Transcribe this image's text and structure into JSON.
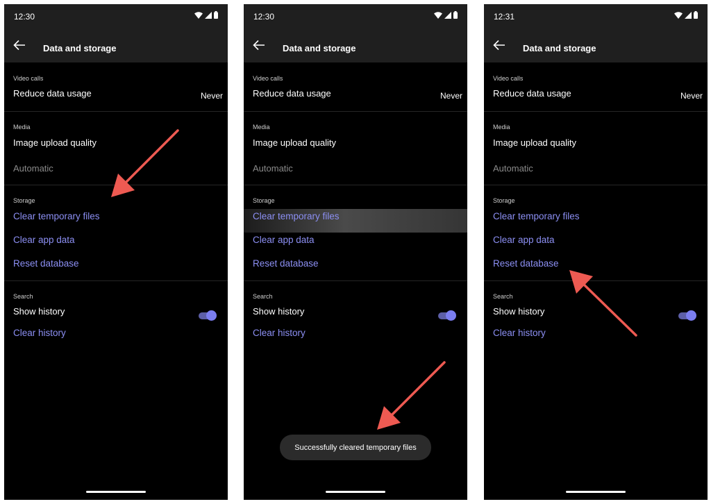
{
  "colors": {
    "background": "#000000",
    "app_bar": "#1f1f1f",
    "link": "#8c8ff3",
    "toggle_on": "#7b7ef0",
    "annotation_arrow": "#ee5a52"
  },
  "screens": [
    {
      "status": {
        "time": "12:30",
        "icons": [
          "wifi-icon",
          "signal-icon",
          "battery-icon"
        ]
      },
      "header": {
        "title": "Data and storage",
        "back_icon": "arrow-left-icon"
      },
      "video_calls": {
        "label": "Video calls",
        "reduce_data": "Reduce data usage",
        "reduce_data_value": "Never"
      },
      "media": {
        "label": "Media",
        "image_quality": "Image upload quality",
        "image_quality_value": "Automatic"
      },
      "storage": {
        "label": "Storage",
        "clear_temp": "Clear temporary files",
        "clear_app_data": "Clear app data",
        "reset_db": "Reset database"
      },
      "search": {
        "label": "Search",
        "show_history": "Show history",
        "show_history_on": true,
        "clear_history": "Clear history"
      }
    },
    {
      "status": {
        "time": "12:30",
        "icons": [
          "wifi-icon",
          "signal-icon",
          "battery-icon"
        ]
      },
      "header": {
        "title": "Data and storage",
        "back_icon": "arrow-left-icon"
      },
      "video_calls": {
        "label": "Video calls",
        "reduce_data": "Reduce data usage",
        "reduce_data_value": "Never"
      },
      "media": {
        "label": "Media",
        "image_quality": "Image upload quality",
        "image_quality_value": "Automatic"
      },
      "storage": {
        "label": "Storage",
        "clear_temp": "Clear temporary files",
        "clear_app_data": "Clear app data",
        "reset_db": "Reset database"
      },
      "search": {
        "label": "Search",
        "show_history": "Show history",
        "show_history_on": true,
        "clear_history": "Clear history"
      },
      "toast": "Successfully cleared temporary files"
    },
    {
      "status": {
        "time": "12:31",
        "icons": [
          "wifi-icon",
          "signal-icon",
          "battery-icon"
        ]
      },
      "header": {
        "title": "Data and storage",
        "back_icon": "arrow-left-icon"
      },
      "video_calls": {
        "label": "Video calls",
        "reduce_data": "Reduce data usage",
        "reduce_data_value": "Never"
      },
      "media": {
        "label": "Media",
        "image_quality": "Image upload quality",
        "image_quality_value": "Automatic"
      },
      "storage": {
        "label": "Storage",
        "clear_temp": "Clear temporary files",
        "clear_app_data": "Clear app data",
        "reset_db": "Reset database"
      },
      "search": {
        "label": "Search",
        "show_history": "Show history",
        "show_history_on": true,
        "clear_history": "Clear history"
      }
    }
  ]
}
